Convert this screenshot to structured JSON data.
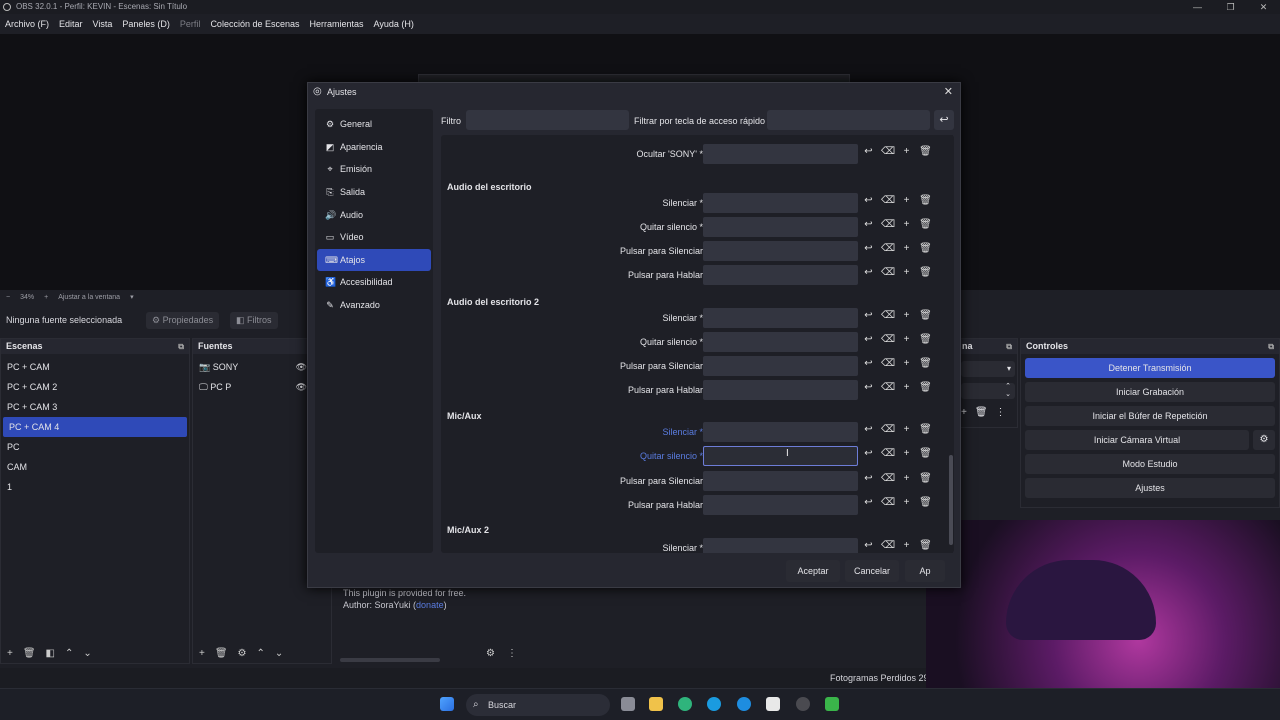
{
  "window": {
    "title": "OBS 32.0.1 - Perfil: KEVIN - Escenas: Sin Título",
    "minimize": "—",
    "maximize": "❐",
    "close": "✕"
  },
  "menu": [
    "Archivo (F)",
    "Editar",
    "Vista",
    "Paneles (D)",
    "Perfil",
    "Colección de Escenas",
    "Herramientas",
    "Ayuda (H)"
  ],
  "zoombar": {
    "minus": "−",
    "zoom": "34%",
    "plus": "+",
    "fit": "Ajustar a la ventana",
    "arrow": "▾"
  },
  "sourcebar": {
    "label": "Ninguna fuente seleccionada",
    "properties": "Propiedades",
    "filters": "Filtros"
  },
  "scenes": {
    "title": "Escenas",
    "items": [
      "PC + CAM",
      "PC + CAM 2",
      "PC + CAM 3",
      "PC + CAM 4",
      "PC",
      "CAM",
      "1"
    ],
    "selected_index": 3
  },
  "sources": {
    "title": "Fuentes",
    "items": [
      "SONY",
      "PC P"
    ]
  },
  "partial_dock": {
    "title": "na"
  },
  "controls": {
    "title": "Controles",
    "buttons": [
      "Detener Transmisión",
      "Iniciar Grabación",
      "Iniciar el Búfer de Repetición",
      "Iniciar Cámara Virtual",
      "Modo Estudio",
      "Ajustes"
    ]
  },
  "plugin_info": {
    "line1": "This plugin is provided for free.",
    "line2_prefix": "Author: SoraYuki (",
    "link": "donate",
    "line2_suffix": ")"
  },
  "statusbar": {
    "dropped": "Fotogramas Perdidos 29"
  },
  "taskbar": {
    "search": "Buscar"
  },
  "dialog": {
    "title": "Ajustes",
    "nav": [
      {
        "label": "General",
        "icon": "gear-icon"
      },
      {
        "label": "Apariencia",
        "icon": "palette-icon"
      },
      {
        "label": "Emisión",
        "icon": "antenna-icon"
      },
      {
        "label": "Salida",
        "icon": "output-icon"
      },
      {
        "label": "Audio",
        "icon": "speaker-icon"
      },
      {
        "label": "Vídeo",
        "icon": "monitor-icon"
      },
      {
        "label": "Atajos",
        "icon": "keyboard-icon"
      },
      {
        "label": "Accesibilidad",
        "icon": "accessibility-icon"
      },
      {
        "label": "Avanzado",
        "icon": "wrench-icon"
      }
    ],
    "selected_nav": 6,
    "filter_label": "Filtro",
    "filter_value": "",
    "hotkey_filter_label": "Filtrar por tecla de acceso rápido",
    "hotkey_filter_value": "",
    "top_row": {
      "label": "Ocultar 'SONY' *"
    },
    "sections": [
      {
        "title": "Audio del escritorio",
        "rows": [
          "Silenciar *",
          "Quitar silencio *",
          "Pulsar para Silenciar",
          "Pulsar para Hablar"
        ]
      },
      {
        "title": "Audio del escritorio 2",
        "rows": [
          "Silenciar *",
          "Quitar silencio *",
          "Pulsar para Silenciar",
          "Pulsar para Hablar"
        ]
      },
      {
        "title": "Mic/Aux",
        "rows": [
          "Silenciar *",
          "Quitar silencio *",
          "Pulsar para Silenciar",
          "Pulsar para Hablar"
        ]
      },
      {
        "title": "Mic/Aux 2",
        "rows": [
          "Silenciar *"
        ]
      }
    ],
    "buttons": {
      "accept": "Aceptar",
      "cancel": "Cancelar",
      "apply": "Ap"
    }
  },
  "colors": {
    "accent": "#2f4ab8",
    "link": "#5a7ce0",
    "background": "#1e1f26"
  }
}
